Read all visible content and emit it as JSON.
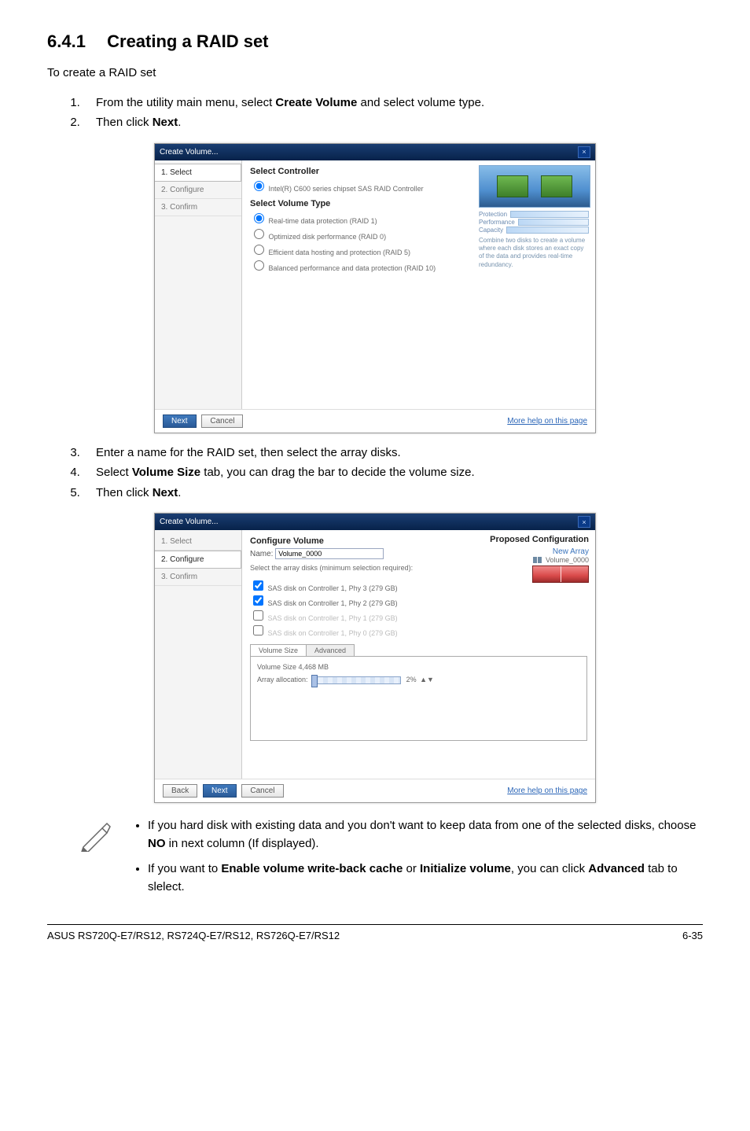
{
  "heading": {
    "number": "6.4.1",
    "title": "Creating a RAID set"
  },
  "intro": "To create a RAID set",
  "steps_a": [
    {
      "pre": "From the utility main menu, select ",
      "bold": "Create Volume",
      "post": " and select volume type."
    },
    {
      "pre": "Then click ",
      "bold": "Next",
      "post": "."
    }
  ],
  "module1": {
    "title": "Create Volume...",
    "wizard": [
      "1. Select",
      "2. Configure",
      "3. Confirm"
    ],
    "active_step": 0,
    "sec1": "Select Controller",
    "sub1": "Intel(R) C600 series chipset SAS RAID Controller",
    "sec2": "Select Volume Type",
    "radios": [
      "Real-time data protection (RAID 1)",
      "Optimized disk performance (RAID 0)",
      "Efficient data hosting and protection (RAID 5)",
      "Balanced performance and data protection (RAID 10)"
    ],
    "meters": [
      "Protection",
      "Performance",
      "Capacity"
    ],
    "desc": "Combine two disks to create a volume where each disk stores an exact copy of the data and provides real-time redundancy.",
    "btn_next": "Next",
    "btn_cancel": "Cancel",
    "help": "More help on this page"
  },
  "steps_b": [
    {
      "pre": "Enter a name for the RAID set, then select the array disks."
    },
    {
      "pre": "Select ",
      "bold": "Volume Size",
      "post": " tab, you can drag the bar to decide the volume size."
    },
    {
      "pre": "Then click ",
      "bold": "Next",
      "post": "."
    }
  ],
  "module2": {
    "title": "Create Volume...",
    "wizard": [
      "1. Select",
      "2. Configure",
      "3. Confirm"
    ],
    "active_step": 1,
    "sec": "Configure Volume",
    "name_label": "Name:",
    "name_value": "Volume_0000",
    "disk_prompt": "Select the array disks (minimum selection required):",
    "disks": [
      "SAS disk on Controller 1, Phy 3 (279 GB)",
      "SAS disk on Controller 1, Phy 2 (279 GB)",
      "SAS disk on Controller 1, Phy 1 (279 GB)",
      "SAS disk on Controller 1, Phy 0 (279 GB)"
    ],
    "tab_vs": "Volume Size",
    "tab_adv": "Advanced",
    "vs_label": "Volume Size 4,468 MB",
    "alloc": "Array allocation:",
    "alloc_pct": "2%",
    "prop_title": "Proposed Configuration",
    "new_array": "New Array",
    "vol_name": "Volume_0000",
    "btn_back": "Back",
    "btn_next": "Next",
    "btn_cancel": "Cancel",
    "help": "More help on this page"
  },
  "notes": [
    {
      "pre": "If you hard disk with existing data and you don't want to keep data from one of the selected disks, choose ",
      "bold": "NO",
      "post": " in next column (If displayed)."
    },
    {
      "pre": "If you want to ",
      "bold": "Enable volume write-back cache",
      "mid": " or ",
      "bold2": "Initialize volume",
      "post": ", you can click ",
      "bold3": "Advanced",
      "post2": " tab to slelect."
    }
  ],
  "footer": {
    "left": "ASUS RS720Q-E7/RS12, RS724Q-E7/RS12, RS726Q-E7/RS12",
    "right": "6-35"
  }
}
